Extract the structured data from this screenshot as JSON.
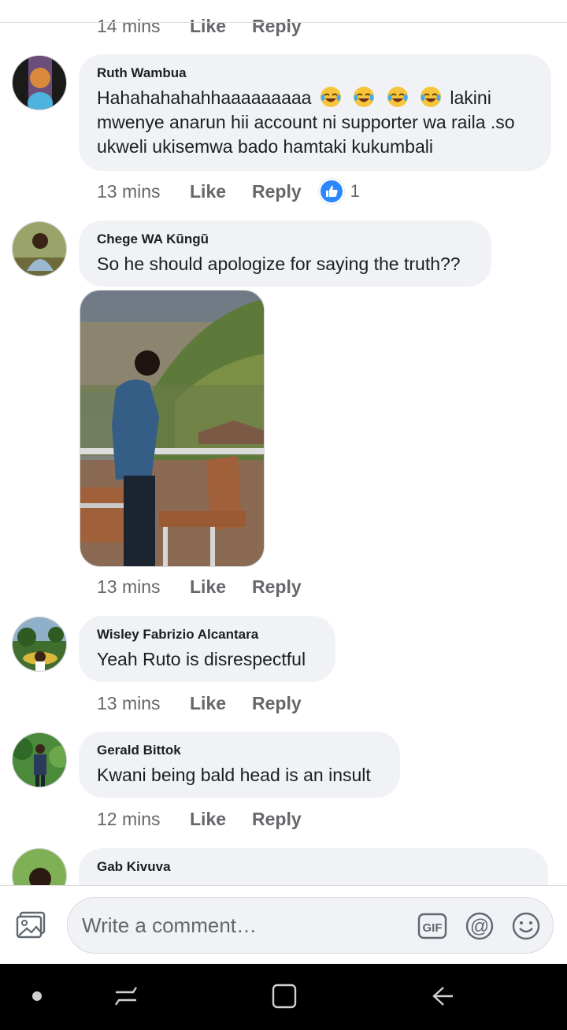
{
  "colors": {
    "bubble": "#f0f2f5",
    "meta_text": "#65676b",
    "like_blue": "#2d88ff",
    "nav_bar": "#000000"
  },
  "clipped_top": {
    "time": "14 mins",
    "like": "Like",
    "reply": "Reply"
  },
  "comments": [
    {
      "author": "Ruth Wambua",
      "text_before_emoji": "Hahahahahahhaaaaaaaaa",
      "emoji": [
        "face-with-tears-of-joy",
        "face-with-tears-of-joy",
        "face-with-tears-of-joy",
        "face-with-tears-of-joy"
      ],
      "text_after_emoji": "lakini mwenye anarun hii account ni supporter wa raila .so ukweli ukisemwa bado hamtaki kukumbali",
      "time": "13 mins",
      "like": "Like",
      "reply": "Reply",
      "reaction_icon": "thumbs-up-icon",
      "reaction_count": "1"
    },
    {
      "author": "Chege WA Kũngũ",
      "text": "So he should apologize for saying the truth??",
      "time": "13 mins",
      "like": "Like",
      "reply": "Reply"
    },
    {
      "author": "Wisley Fabrizio Alcantara",
      "text": "Yeah Ruto is disrespectful",
      "time": "13 mins",
      "like": "Like",
      "reply": "Reply"
    },
    {
      "author": "Gerald Bittok",
      "text": "Kwani being bald head is an insult",
      "time": "12 mins",
      "like": "Like",
      "reply": "Reply"
    },
    {
      "author": "Gab Kivuva"
    }
  ],
  "composer": {
    "placeholder": "Write a comment…",
    "gif_label": "GIF",
    "at_label": "@"
  },
  "icons": {
    "gallery": "gallery-icon",
    "gif": "gif-icon",
    "mention": "at-mention-icon",
    "emoji": "smiley-icon",
    "nav_recents": "recents-icon",
    "nav_home": "home-icon",
    "nav_back": "back-icon"
  }
}
